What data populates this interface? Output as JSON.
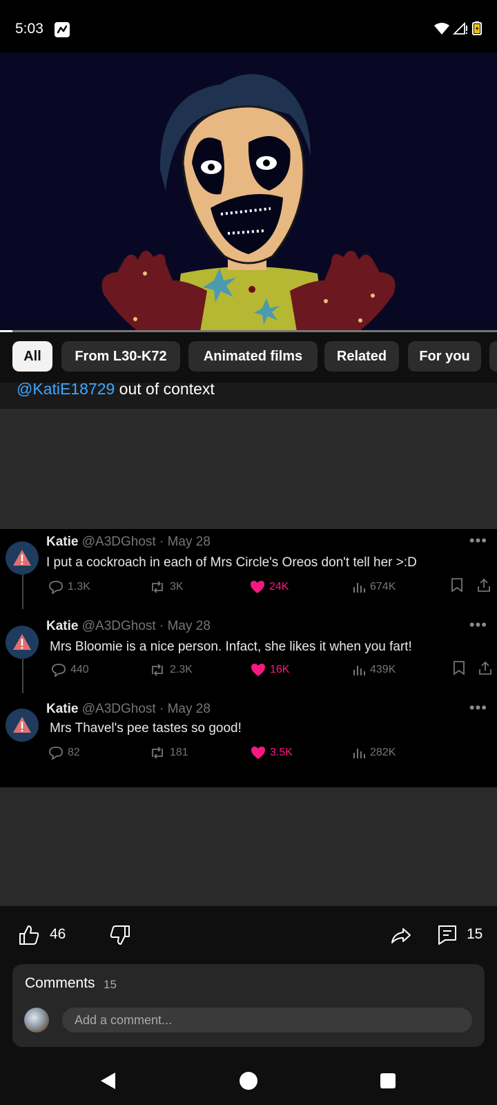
{
  "status_bar": {
    "time": "5:03"
  },
  "chips": [
    {
      "label": "All",
      "active": true
    },
    {
      "label": "From L30-K72",
      "active": false
    },
    {
      "label": "Animated films",
      "active": false
    },
    {
      "label": "Related",
      "active": false
    },
    {
      "label": "For you",
      "active": false
    }
  ],
  "video": {
    "progress_fraction": 0.025
  },
  "description": {
    "mention": "@KatiE18729",
    "text": "out of context"
  },
  "tweets": [
    {
      "name": "Katie",
      "handle": "@A3DGhost",
      "separator": "·",
      "date": "May 28",
      "text": "I put a cockroach in each of Mrs Circle's Oreos don't tell her >:D",
      "replies": "1.3K",
      "retweets": "3K",
      "likes": "24K",
      "views": "674K"
    },
    {
      "name": "Katie",
      "handle": "@A3DGhost",
      "separator": "·",
      "date": "May 28",
      "text": "Mrs Bloomie is a nice person. Infact, she likes it when you fart!",
      "replies": "440",
      "retweets": "2.3K",
      "likes": "16K",
      "views": "439K"
    },
    {
      "name": "Katie",
      "handle": "@A3DGhost",
      "separator": "·",
      "date": "May 28",
      "text": "Mrs Thavel's pee tastes so good!",
      "replies": "82",
      "retweets": "181",
      "likes": "3.5K",
      "views": "282K"
    }
  ],
  "actions": {
    "likes": "46",
    "comments": "15"
  },
  "comments": {
    "title": "Comments",
    "count": "15",
    "placeholder": "Add a comment..."
  },
  "colors": {
    "accent_link": "#3ea6ff",
    "like_pink": "#f91880"
  }
}
